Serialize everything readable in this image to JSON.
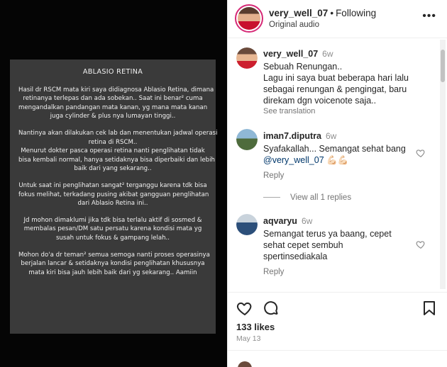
{
  "note": {
    "title": "ABLASIO RETINA",
    "paragraphs": [
      [
        "Hasil dr RSCM mata kiri saya didiagnosa Ablasio Retina, dimana",
        "retinanya terlepas dan ada sobekan.. Saat ini benar² cuma",
        "mengandalkan pandangan mata kanan, yg mana mata kanan",
        "juga cylinder & plus nya lumayan tinggi.."
      ],
      [
        "Nantinya akan dilakukan cek lab dan menentukan jadwal operasi",
        "retina di RSCM..",
        "Menurut dokter pasca operasi retina nanti penglihatan tidak",
        "bisa kembali normal, hanya setidaknya bisa diperbaiki dan lebih",
        "baik dari yang sekarang.."
      ],
      [
        "Untuk saat ini penglihatan sangat² terganggu karena tdk bisa",
        "fokus melihat, terkadang pusing akibat gangguan penglihatan",
        "dari Ablasio Retina ini.."
      ],
      [
        "Jd mohon dimaklumi jika tdk bisa terlalu aktif di sosmed &",
        "membalas pesan/DM satu persatu karena kondisi mata yg",
        "susah untuk fokus & gampang lelah.."
      ],
      [
        "Mohon do'a dr teman² semua semoga nanti proses operasinya",
        "berjalan lancar & setidaknya kondisi penglihatan khususnya",
        "mata kiri bisa jauh lebih baik dari yg sekarang.. Aamiin"
      ]
    ]
  },
  "header": {
    "username": "very_well_07",
    "dot": "•",
    "follow_label": "Following",
    "subtitle": "Original audio",
    "more_icon": "more-horizontal-icon"
  },
  "comments": [
    {
      "username": "very_well_07",
      "time": "6w",
      "lines": [
        "Sebuah Renungan..",
        "Lagu ini saya buat beberapa hari lalu",
        "sebagai renungan & pengingat, baru",
        "direkam dgn voicenote saja.."
      ],
      "see_translation": "See translation"
    },
    {
      "username": "iman7.diputra",
      "time": "6w",
      "line1": "Syafakallah... Semangat sehat bang",
      "mention": "@very_well_07",
      "emoji": "💪🏻💪🏻",
      "reply": "Reply",
      "view_replies": "View all 1 replies"
    },
    {
      "username": "aqvaryu",
      "time": "6w",
      "lines": [
        "Semangat terus ya baang, cepet",
        "sehat cepet sembuh",
        "spertinsediakala"
      ],
      "reply": "Reply"
    }
  ],
  "footer": {
    "likes": "133 likes",
    "date": "May 13"
  },
  "colors": {
    "mention": "#00376b",
    "muted": "#737373",
    "note_bg": "#3a3a3a",
    "story_ring": "#d62976"
  }
}
